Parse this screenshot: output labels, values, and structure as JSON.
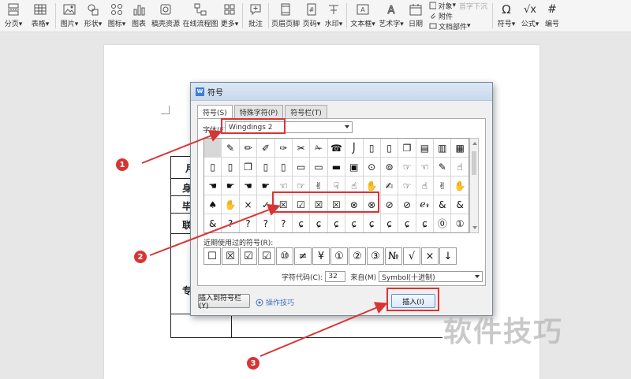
{
  "ribbon": {
    "items": [
      {
        "label": "分页",
        "dropdown": "▾",
        "icon": "page-break-icon"
      },
      {
        "label": "表格",
        "dropdown": "▾",
        "icon": "table-icon"
      },
      {
        "label": "图片",
        "dropdown": "▾",
        "icon": "picture-icon"
      },
      {
        "label": "形状",
        "dropdown": "▾",
        "icon": "shapes-icon"
      },
      {
        "label": "图标",
        "dropdown": "▾",
        "icon": "icons-icon"
      },
      {
        "label": "图表",
        "dropdown": "",
        "icon": "chart-icon"
      },
      {
        "label": "稿壳资源",
        "dropdown": "",
        "icon": "resource-icon"
      },
      {
        "label": "在线流程图",
        "dropdown": "",
        "icon": "flowchart-icon"
      },
      {
        "label": "更多",
        "dropdown": "▾",
        "icon": "more-icon"
      },
      {
        "label": "批注",
        "dropdown": "",
        "icon": "comment-icon"
      },
      {
        "label": "页眉页脚",
        "dropdown": "",
        "icon": "header-footer-icon"
      },
      {
        "label": "页码",
        "dropdown": "▾",
        "icon": "page-number-icon"
      },
      {
        "label": "水印",
        "dropdown": "▾",
        "icon": "watermark-icon"
      },
      {
        "label": "文本框",
        "dropdown": "▾",
        "icon": "textbox-icon"
      },
      {
        "label": "艺术字",
        "dropdown": "▾",
        "icon": "wordart-icon"
      },
      {
        "label": "日期",
        "dropdown": "",
        "icon": "date-icon"
      }
    ],
    "small_items": {
      "object": "对象",
      "first_letter": "首字下沉",
      "attachment": "附件",
      "doc_parts": "文档部件"
    },
    "right_items": [
      {
        "label": "符号",
        "dropdown": "▾",
        "icon": "omega-icon",
        "glyph": "Ω"
      },
      {
        "label": "公式",
        "dropdown": "▾",
        "icon": "formula-icon",
        "glyph": "√x"
      },
      {
        "label": "编号",
        "dropdown": "",
        "icon": "numbering-icon",
        "glyph": "#"
      }
    ]
  },
  "document": {
    "rows": [
      "身",
      "毕",
      "联",
      "专"
    ],
    "first_row": "月"
  },
  "dialog": {
    "title": "符号",
    "logo": "W",
    "tabs": [
      "符号(S)",
      "特殊字符(P)",
      "符号栏(T)"
    ],
    "font_label": "字体(F):",
    "font_value": "Wingdings 2",
    "symbols": [
      "",
      "✎",
      "✏",
      "✐",
      "✑",
      "✂",
      "✁",
      "☎",
      "⌡",
      "▯",
      "▯",
      "❐",
      "▤",
      "▥",
      "▦",
      "▯",
      "▯",
      "❐",
      "▯",
      "▯",
      "▭",
      "▭",
      "▬",
      "▣",
      "⊙",
      "⊚",
      "☞",
      "☜",
      "✎",
      "☝",
      "☚",
      "☛",
      "☚",
      "☛",
      "☜",
      "☞",
      "✌",
      "☟",
      "☝",
      "✋",
      "✍",
      "☞",
      "☝",
      "✌",
      "✋",
      "♠",
      "✋",
      "×",
      "✓",
      "☒",
      "☑",
      "☒",
      "☒",
      "⊗",
      "⊗",
      "⊘",
      "⊘",
      "ℯ𝓇",
      "&",
      "&",
      "&",
      "?",
      "?",
      "?",
      "?",
      "ɕ",
      "ɕ",
      "ɕ",
      "ɕ",
      "ɕ",
      "ɕ",
      "ɕ",
      "ɕ",
      "⓪",
      "①"
    ],
    "recent_label": "近期使用过的符号(R):",
    "recent": [
      "☐",
      "☒",
      "☑",
      "☑",
      "⑩",
      "≠",
      "¥",
      "①",
      "②",
      "③",
      "№",
      "√",
      "×",
      "↓"
    ],
    "code_label": "字符代码(C):",
    "code_value": "32",
    "from_label": "来自(M)",
    "from_value": "Symbol(十进制)",
    "insert_to_bar": "插入到符号栏(Y)",
    "tips": "操作技巧",
    "insert_button": "插入(I)"
  },
  "annotations": {
    "badges": [
      "1",
      "2",
      "3"
    ],
    "color": "#d93434"
  },
  "watermark": "软件技巧",
  "colors": {
    "accent": "#3b7ed6",
    "annotation": "#d93434",
    "link": "#3a6fbf"
  }
}
